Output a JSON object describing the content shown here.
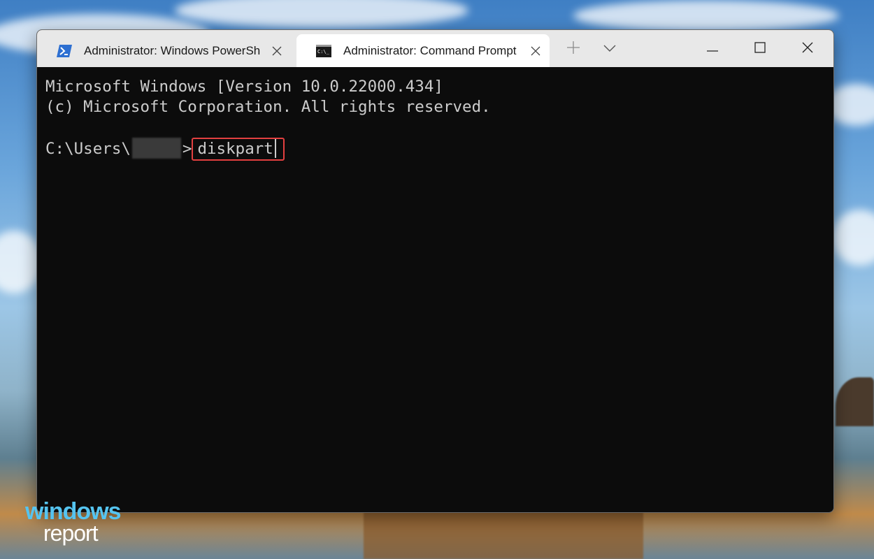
{
  "tabs": [
    {
      "label": "Administrator: Windows PowerShell",
      "icon": "powershell-icon"
    },
    {
      "label": "Administrator: Command Prompt",
      "icon": "command-prompt-icon"
    }
  ],
  "window_controls": [
    "new-tab-icon",
    "dropdown-chevron-icon",
    "minimize-icon",
    "maximize-icon",
    "close-icon"
  ],
  "terminal": {
    "line1": "Microsoft Windows [Version 10.0.22000.434]",
    "line2": "(c) Microsoft Corporation. All rights reserved.",
    "prompt_prefix": "C:\\Users\\",
    "prompt_suffix": ">",
    "command": "diskpart"
  },
  "watermark": {
    "line1": "windows",
    "line2": "report"
  },
  "colors": {
    "highlight": "#e34040",
    "terminal_bg": "#0c0c0c",
    "terminal_text": "#cccccc"
  }
}
